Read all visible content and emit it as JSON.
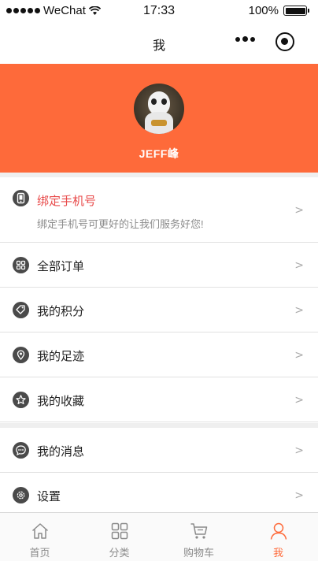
{
  "status_bar": {
    "carrier": "WeChat",
    "time": "17:33",
    "battery": "100%"
  },
  "nav": {
    "title": "我",
    "more_icon": "more-dots-icon",
    "close_icon": "capsule-close-icon"
  },
  "profile": {
    "username": "JEFF峰",
    "background_color": "#fe6a3a"
  },
  "menu": {
    "bind_phone": {
      "label": "绑定手机号",
      "subtitle": "绑定手机号可更好的让我们服务好您!",
      "icon": "phone-icon",
      "arrow": ">"
    },
    "items": [
      {
        "label": "全部订单",
        "icon": "grid-icon",
        "arrow": ">"
      },
      {
        "label": "我的积分",
        "icon": "tag-icon",
        "arrow": ">"
      },
      {
        "label": "我的足迹",
        "icon": "location-pin-icon",
        "arrow": ">"
      },
      {
        "label": "我的收藏",
        "icon": "star-icon",
        "arrow": ">"
      }
    ],
    "items2": [
      {
        "label": "我的消息",
        "icon": "message-icon",
        "arrow": ">"
      },
      {
        "label": "设置",
        "icon": "gear-icon",
        "arrow": ">"
      }
    ]
  },
  "tabs": [
    {
      "label": "首页",
      "icon": "home-icon",
      "active": false
    },
    {
      "label": "分类",
      "icon": "category-grid-icon",
      "active": false
    },
    {
      "label": "购物车",
      "icon": "cart-icon",
      "active": false
    },
    {
      "label": "我",
      "icon": "user-icon",
      "active": true
    }
  ],
  "colors": {
    "accent": "#fe6a3a",
    "warning_text": "#e84a4a",
    "icon_bg": "#4a4a4a"
  }
}
